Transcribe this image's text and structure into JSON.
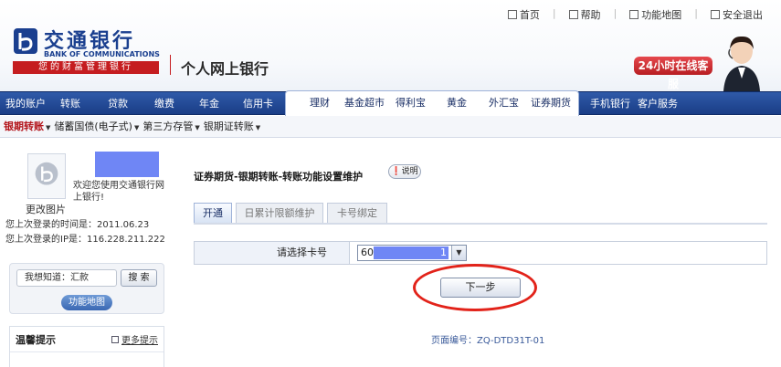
{
  "brand": {
    "name_cn": "交通银行",
    "name_en": "BANK OF COMMUNICATIONS",
    "slogan": "您的财富管理银行",
    "site_title": "个人网上银行"
  },
  "toplinks": [
    {
      "label": "首页",
      "icon": "home-icon"
    },
    {
      "label": "帮助",
      "icon": "help-icon"
    },
    {
      "label": "功能地图",
      "icon": "map-icon"
    },
    {
      "label": "安全退出",
      "icon": "logout-icon"
    }
  ],
  "customer_service": {
    "label": "24小时在线客服"
  },
  "nav": {
    "left": [
      "我的账户",
      "转账",
      "贷款",
      "缴费",
      "年金",
      "信用卡"
    ],
    "center": [
      "理财",
      "基金超市",
      "得利宝",
      "黄金",
      "外汇宝",
      "证券期货"
    ],
    "right": [
      "手机银行",
      "客户服务"
    ]
  },
  "subnav": {
    "items": [
      "银期转账",
      "储蓄国债(电子式)",
      "第三方存管",
      "银期证转账"
    ],
    "active_index": 0
  },
  "profile": {
    "change_photo": "更改图片",
    "welcome": "欢迎您使用交通银行网上银行!",
    "last_login_time": "您上次登录的时间是：2011.06.23",
    "last_login_ip": "您上次登录的IP是：116.228.211.222"
  },
  "search": {
    "placeholder": "我想知道：汇款",
    "button": "搜 索",
    "function_map": "功能地图"
  },
  "tips": {
    "title": "温馨提示",
    "more": "更多提示"
  },
  "main": {
    "heading": "证券期货-银期转账-转账功能设置维护",
    "help_button": "说明",
    "tabs": [
      "开通",
      "日累计限额维护",
      "卡号绑定"
    ],
    "active_tab": 0,
    "form": {
      "label": "请选择卡号",
      "card_prefix": "60",
      "card_suffix": "1"
    },
    "next_button": "下一步",
    "page_code": "页面编号：ZQ-DTD31T-01"
  },
  "colors": {
    "brand_blue": "#1a3f8f",
    "nav_blue": "#2a4f9c",
    "accent_red": "#c51d20",
    "annotation_red": "#e2231a"
  }
}
